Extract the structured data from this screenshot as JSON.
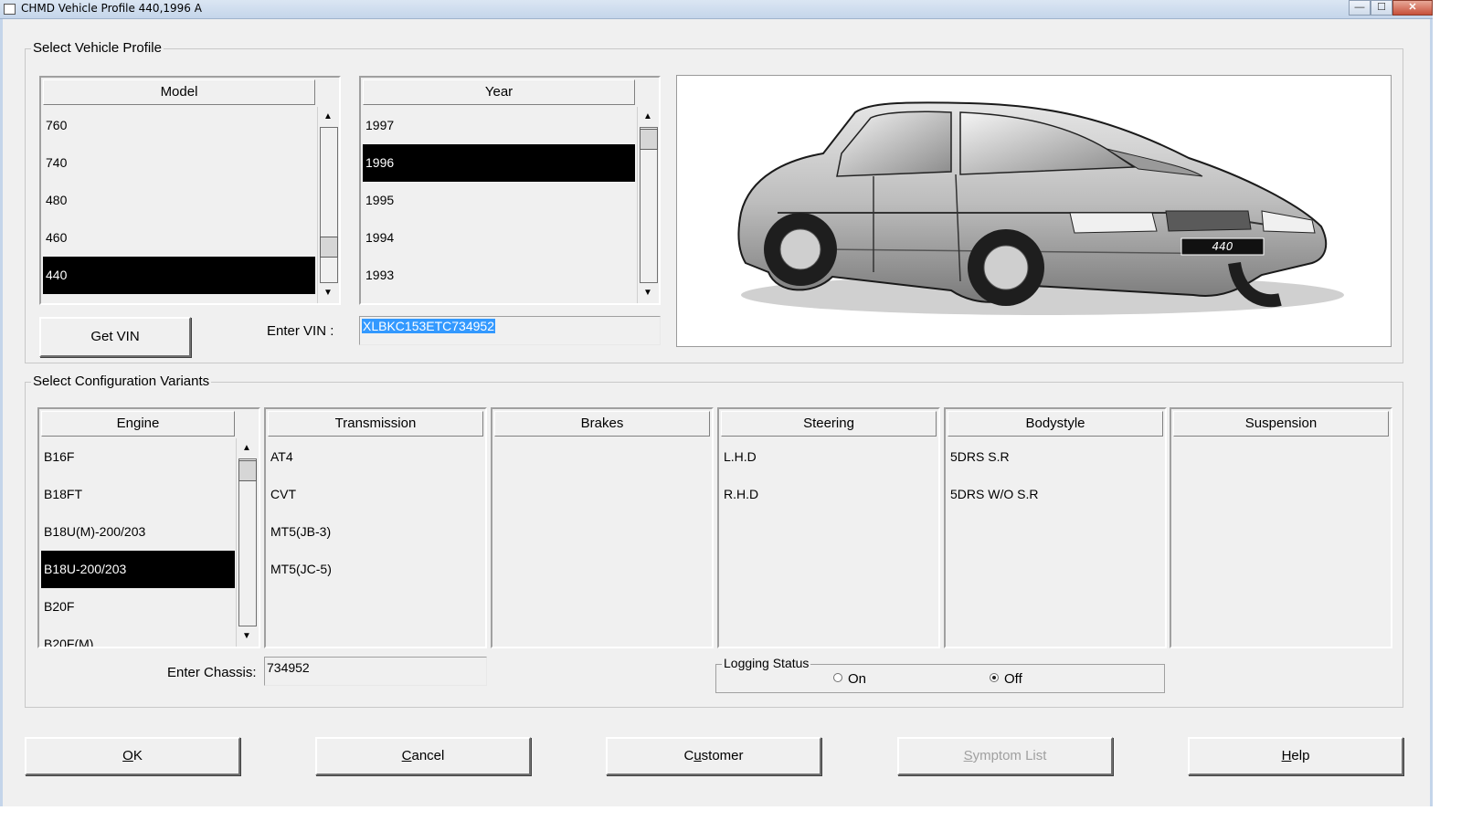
{
  "window": {
    "title": "CHMD Vehicle Profile 440,1996 A",
    "buttons": [
      "minimize",
      "maximize",
      "close"
    ]
  },
  "vehicle_profile": {
    "legend": "Select Vehicle Profile",
    "model": {
      "header": "Model",
      "items": [
        "760",
        "740",
        "480",
        "460",
        "440"
      ],
      "selected": "440"
    },
    "year": {
      "header": "Year",
      "items": [
        "1997",
        "1996",
        "1995",
        "1994",
        "1993"
      ],
      "selected": "1996"
    },
    "get_vin_label": "Get VIN",
    "enter_vin_label": "Enter VIN :",
    "vin_value": "XLBKC153ETC734952",
    "car_badge": "440"
  },
  "config": {
    "legend": "Select Configuration Variants",
    "engine": {
      "header": "Engine",
      "items": [
        "B16F",
        "B18FT",
        "B18U(M)-200/203",
        "B18U-200/203",
        "B20F",
        "B20F(M)"
      ],
      "selected": "B18U-200/203"
    },
    "transmission": {
      "header": "Transmission",
      "items": [
        "AT4",
        "CVT",
        "MT5(JB-3)",
        "MT5(JC-5)"
      ]
    },
    "brakes": {
      "header": "Brakes",
      "items": []
    },
    "steering": {
      "header": "Steering",
      "items": [
        "L.H.D",
        "R.H.D"
      ]
    },
    "bodystyle": {
      "header": "Bodystyle",
      "items": [
        "5DRS S.R",
        "5DRS W/O S.R"
      ]
    },
    "suspension": {
      "header": "Suspension",
      "items": []
    },
    "enter_chassis_label": "Enter Chassis:",
    "chassis_value": "734952",
    "logging": {
      "legend": "Logging Status",
      "on_label": "On",
      "off_label": "Off",
      "selected": "Off"
    }
  },
  "buttons": {
    "ok": {
      "underline": "O",
      "rest": "K"
    },
    "cancel": {
      "underline": "C",
      "rest": "ancel"
    },
    "customer": {
      "pre": "C",
      "underline": "u",
      "rest": "stomer"
    },
    "symptom_list": {
      "underline": "S",
      "rest": "ymptom List",
      "disabled": true
    },
    "help": {
      "underline": "H",
      "rest": "elp"
    }
  }
}
